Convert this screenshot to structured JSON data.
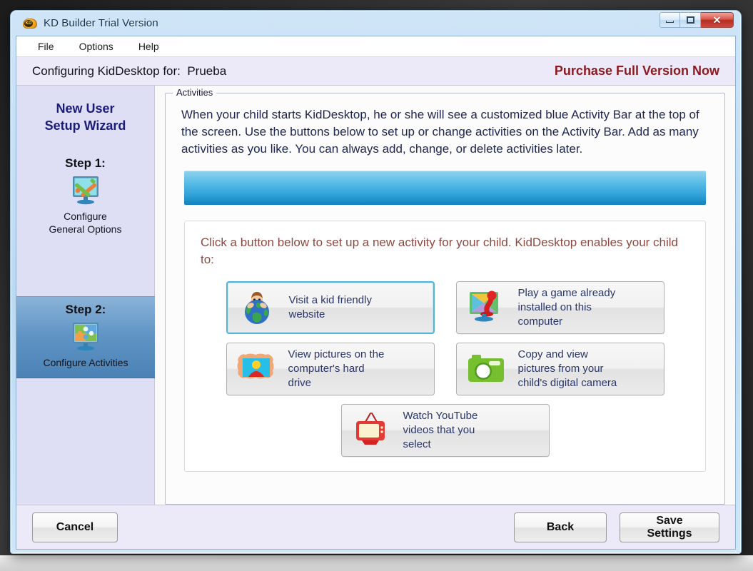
{
  "window": {
    "title": "KD Builder Trial Version",
    "app_icon": "kd-app-icon",
    "minimize_label": "Minimize",
    "maximize_label": "Maximize",
    "close_label": "Close",
    "close_glyph": "✕"
  },
  "menubar": {
    "items": [
      {
        "label": "File"
      },
      {
        "label": "Options"
      },
      {
        "label": "Help"
      }
    ]
  },
  "header": {
    "config_label": "Configuring KidDesktop for:  Prueba",
    "purchase_label": "Purchase Full Version Now",
    "purchase_color": "#8d1a20"
  },
  "sidebar": {
    "wizard_title": "New User\nSetup Wizard",
    "background_color": "#dedef5",
    "steps": [
      {
        "step_label": "Step 1:",
        "caption": "Configure\nGeneral Options",
        "icon": "monitor-tools-icon",
        "selected": false
      },
      {
        "step_label": "Step 2:",
        "caption": "Configure Activities",
        "icon": "monitor-puzzle-icon",
        "selected": true
      }
    ]
  },
  "main": {
    "group_legend": "Activities",
    "intro_text": "When your child starts KidDesktop, he or she will see a customized blue Activity Bar at the top of the screen.  Use the buttons below to set up or change activities on the Activity Bar.  Add as many activities as you like.  You can always add, change, or delete activities later.",
    "activity_bar_colors": [
      "#8fd3ef",
      "#1083be"
    ],
    "panel_instruction": "Click a button below to set up a new activity for your child.  KidDesktop enables your child to:",
    "panel_instruction_color": "#8b4a42",
    "activity_buttons": [
      {
        "label": "Visit a kid friendly\nwebsite",
        "icon": "globe-child-icon",
        "focused": true
      },
      {
        "label": "Play a game already\ninstalled on this\ncomputer",
        "icon": "monitor-joystick-icon",
        "focused": false
      },
      {
        "label": "View pictures on the\ncomputer's hard\ndrive",
        "icon": "picture-frame-icon",
        "focused": false
      },
      {
        "label": "Copy and view\npictures from your\nchild's digital camera",
        "icon": "camera-icon",
        "focused": false
      },
      {
        "label": "Watch YouTube\nvideos that you\nselect",
        "icon": "television-icon",
        "focused": false
      }
    ]
  },
  "footer": {
    "cancel_label": "Cancel",
    "back_label": "Back",
    "save_label": "Save Settings"
  }
}
